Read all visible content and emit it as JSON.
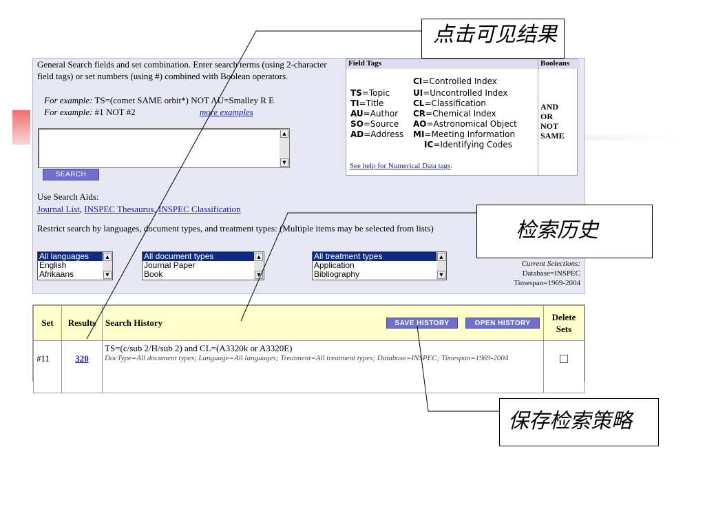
{
  "search_form": {
    "intro": "General Search fields and set combination. Enter search terms (using 2-character field tags) or set numbers (using #) combined with Boolean operators.",
    "example1_label": "For example:",
    "example1_text": "TS=(comet SAME orbit*) NOT AU=Smalley R E",
    "example2_label": "For example:",
    "example2_text": "#1 NOT #2",
    "more_examples": "more examples",
    "query_value": "",
    "search_button": "SEARCH"
  },
  "field_tags": {
    "header": "Field Tags",
    "booleans_header": "Booleans",
    "left": [
      {
        "code": "TS",
        "label": "=Topic"
      },
      {
        "code": "TI",
        "label": "=Title"
      },
      {
        "code": "AU",
        "label": "=Author"
      },
      {
        "code": "SO",
        "label": "=Source"
      },
      {
        "code": "AD",
        "label": "=Address"
      }
    ],
    "right": [
      {
        "code": "CI",
        "label": "=Controlled Index"
      },
      {
        "code": "UI",
        "label": "=Uncontrolled Index"
      },
      {
        "code": "CL",
        "label": "=Classification"
      },
      {
        "code": "CR",
        "label": "=Chemical Index"
      },
      {
        "code": "AO",
        "label": "=Astronomical Object"
      },
      {
        "code": "MI",
        "label": "=Meeting Information"
      },
      {
        "code": "IC",
        "label": "=Identifying Codes"
      }
    ],
    "booleans": [
      "AND",
      "OR",
      "NOT",
      "SAME"
    ],
    "help_link": "See help for Numerical Data tags",
    "help_suffix": "."
  },
  "search_aids": {
    "label": "Use Search Aids:",
    "links": [
      "Journal List",
      "INSPEC Thesaurus",
      "INSPEC Classification"
    ],
    "separator": ", "
  },
  "restrict_text": "Restrict search by languages, document types, and treatment types: (Multiple items may be selected from lists)",
  "listboxes": {
    "languages": [
      "All languages",
      "English",
      "Afrikaans"
    ],
    "doc_types": [
      "All document types",
      "Journal Paper",
      "Book"
    ],
    "treatment_types": [
      "All treatment types",
      "Application",
      "Bibliography"
    ]
  },
  "current_selections": {
    "label": "Current Selections:",
    "database": "Database=INSPEC",
    "timespan": "Timespan=1969-2004"
  },
  "history": {
    "col_set": "Set",
    "col_results": "Results",
    "col_history": "Search History",
    "save_button": "SAVE HISTORY",
    "open_button": "OPEN HISTORY",
    "col_delete": "Delete Sets",
    "rows": [
      {
        "set": "#11",
        "results": "320",
        "query": "TS=(c/sub 2/H/sub 2) and CL=(A3320k or A3320E)",
        "meta": "DocType=All document types; Language=All languages; Treatment=All treatment types; Database=INSPEC; Timespan=1969-2004"
      }
    ]
  },
  "callouts": {
    "results": "点击可见结果",
    "history": "检索历史",
    "save": "保存检索策略"
  }
}
